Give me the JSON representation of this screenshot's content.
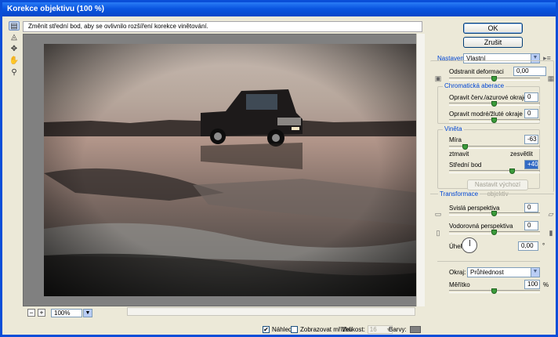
{
  "window": {
    "title": "Korekce objektivu (100 %)"
  },
  "hint": "Změnit střední bod, aby se ovlivnilo rozšíření korekce vinětování.",
  "tools": [
    "remove-distortion-tool",
    "straighten-tool",
    "move-grid-tool",
    "hand-tool",
    "zoom-tool"
  ],
  "buttons": {
    "ok": "OK",
    "cancel": "Zrušit",
    "reset": "Nastavit výchozí objektiv"
  },
  "settings": {
    "label": "Nastavení:",
    "value": "Vlastní"
  },
  "distortion": {
    "label": "Odstranit deformaci",
    "value": "0,00",
    "level": 0.5
  },
  "chromatic": {
    "legend": "Chromatická aberace",
    "red_cyan": {
      "label": "Opravit červ./azurové okraje",
      "value": "0",
      "level": 0.5
    },
    "blue_yellow": {
      "label": "Opravit modré/žluté okraje",
      "value": "0",
      "level": 0.5
    }
  },
  "vignette": {
    "legend": "Viněta",
    "amount": {
      "label": "Míra",
      "value": "-63",
      "level": 0.185
    },
    "darken": "ztmavit",
    "lighten": "zesvětlit",
    "midpoint": {
      "label": "Střední bod",
      "value": "+40",
      "level": 0.7
    }
  },
  "transform": {
    "legend": "Transformace",
    "vertical": {
      "label": "Svislá perspektiva",
      "value": "0",
      "level": 0.5
    },
    "horizontal": {
      "label": "Vodorovná perspektiva",
      "value": "0",
      "level": 0.5
    },
    "angle": {
      "label": "Úhel:",
      "value": "0,00",
      "unit": "°"
    },
    "edge": {
      "label": "Okraj:",
      "value": "Průhlednost"
    },
    "scale": {
      "label": "Měřítko",
      "value": "100",
      "unit": "%",
      "level": 0.5
    }
  },
  "zoom": {
    "value": "100%"
  },
  "bottom": {
    "preview": "Náhled",
    "show_grid": "Zobrazovat mřížku",
    "size_label": "Velikost:",
    "size_value": "16",
    "color_label": "Barvy:"
  },
  "colors": {
    "accent": "#0046d5",
    "titlebar": "#0a55e0",
    "grid_color": "#808080"
  }
}
